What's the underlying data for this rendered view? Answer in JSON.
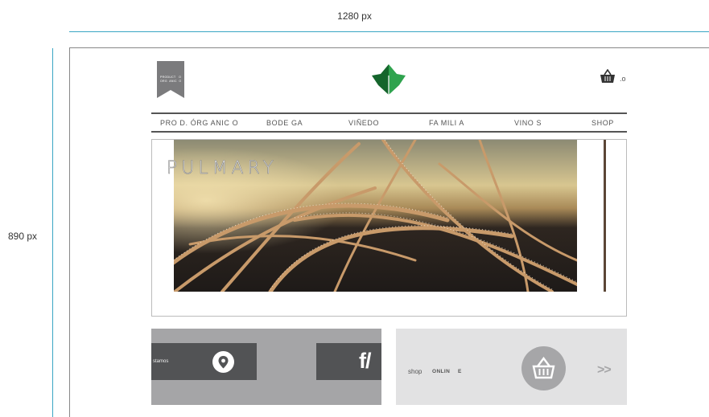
{
  "annotations": {
    "width_label": "1280 px",
    "height_label": "890 px"
  },
  "header": {
    "ribbon_text": "PRODUCT   O\nORG  ANIC  O",
    "cart_count": ".o"
  },
  "nav": {
    "items": [
      {
        "label": "PRO D. ÓRG ANIC O"
      },
      {
        "label": "BODE GA"
      },
      {
        "label": "VIÑEDO"
      },
      {
        "label": "FA MILI A"
      },
      {
        "label": "VINO S"
      },
      {
        "label": "SHOP"
      }
    ]
  },
  "hero": {
    "title": "PULMARY"
  },
  "promo": {
    "location_text": "stamos",
    "social_text": "f/",
    "shop_text": "shop",
    "online_text": "ONLIN",
    "online_suffix": "E",
    "next_arrows": ">>"
  },
  "colors": {
    "accent_blue": "#3aa6c4",
    "leaf_green": "#1e8a3c",
    "dark_panel": "#525355",
    "grey_panel": "#a5a5a7",
    "light_panel": "#e2e2e3"
  }
}
